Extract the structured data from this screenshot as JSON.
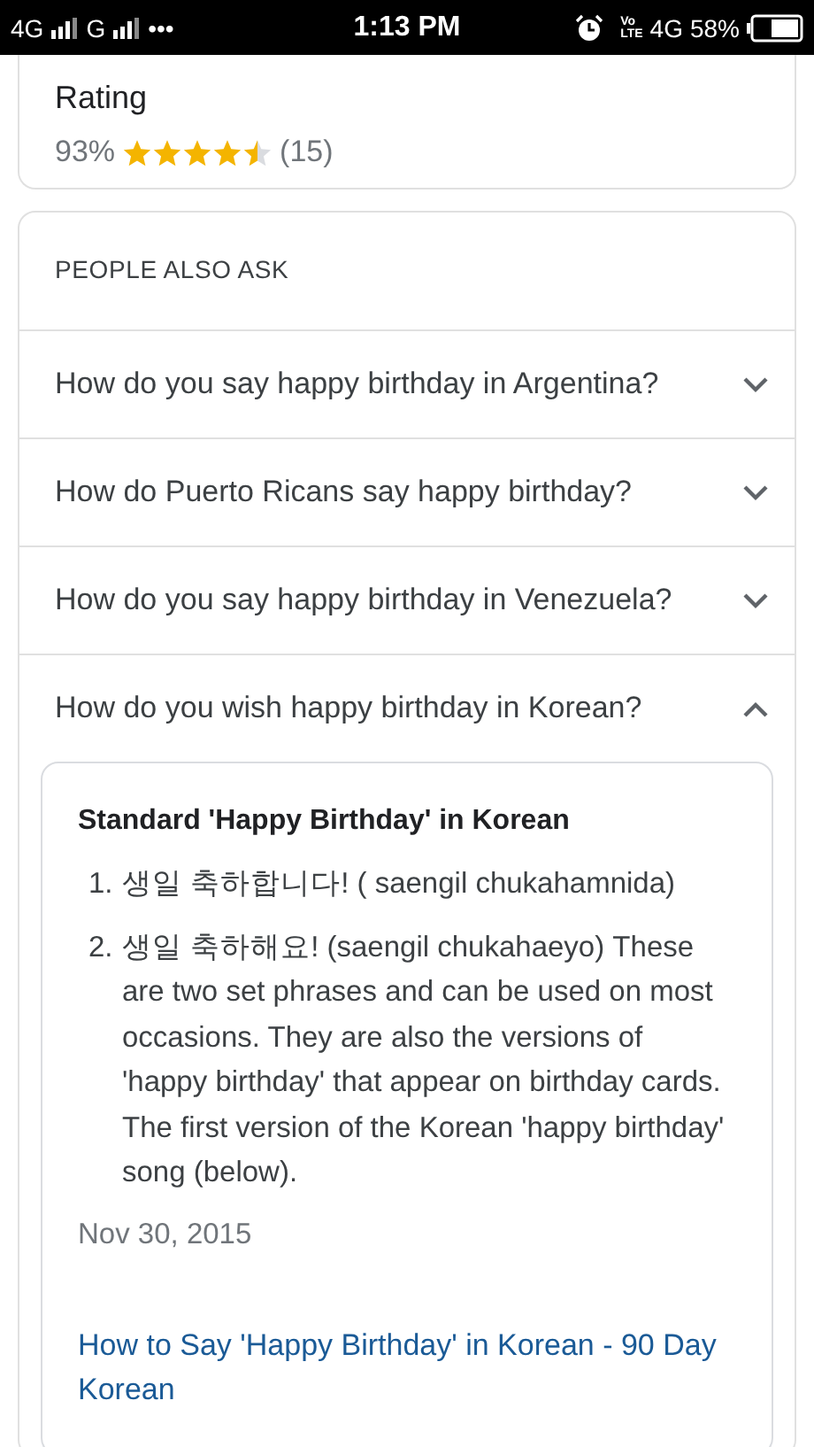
{
  "status_bar": {
    "left": [
      {
        "kind": "text",
        "text": "4G"
      },
      {
        "kind": "signal"
      },
      {
        "kind": "text",
        "text": "G"
      },
      {
        "kind": "signal"
      },
      {
        "kind": "text",
        "text": "•••"
      }
    ],
    "time": "1:13 PM",
    "volte": [
      "Vo",
      "LTE"
    ],
    "network": "4G",
    "battery": "58%"
  },
  "rating_card": {
    "title": "Rating",
    "percent": "93%",
    "stars": 4.5,
    "count": "(15)"
  },
  "people_also_ask": {
    "heading": "PEOPLE ALSO ASK",
    "questions": [
      {
        "text": "How do you say happy birthday in Argentina?",
        "expanded": false
      },
      {
        "text": "How do Puerto Ricans say happy birthday?",
        "expanded": false
      },
      {
        "text": "How do you say happy birthday in Venezuela?",
        "expanded": false
      },
      {
        "text": "How do you wish happy birthday in Korean?",
        "expanded": true
      }
    ],
    "answer": {
      "title": "Standard 'Happy Birthday' in Korean",
      "items": [
        {
          "number": "1.",
          "text": "생일 축하합니다! ( saengil chukahamnida)"
        },
        {
          "number": "2.",
          "text": "생일 축하해요! (saengil chukahaeyo) These are two set phrases and can be used on most occasions. They are also the versions of 'happy birthday' that appear on birthday cards. The first version of the Korean 'happy birthday' song (below)."
        }
      ],
      "date": "Nov 30, 2015",
      "link": "How to Say 'Happy Birthday' in Korean - 90 Day Korean"
    }
  }
}
